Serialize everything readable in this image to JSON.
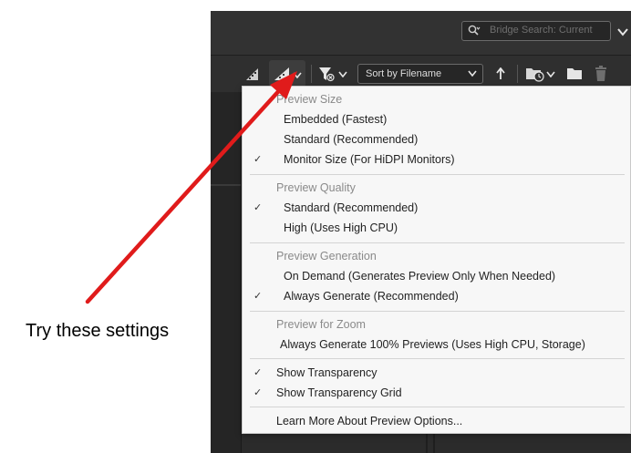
{
  "search": {
    "placeholder": "Bridge Search: Current"
  },
  "toolbar": {
    "sort_label": "Sort by Filename"
  },
  "menu": {
    "sections": [
      {
        "header": "Preview Size",
        "items": [
          {
            "label": "Embedded (Fastest)",
            "checked": false
          },
          {
            "label": "Standard (Recommended)",
            "checked": false
          },
          {
            "label": "Monitor Size (For HiDPI Monitors)",
            "checked": true
          }
        ]
      },
      {
        "header": "Preview Quality",
        "items": [
          {
            "label": "Standard (Recommended)",
            "checked": true
          },
          {
            "label": "High (Uses High CPU)",
            "checked": false
          }
        ]
      },
      {
        "header": "Preview Generation",
        "items": [
          {
            "label": "On Demand (Generates Preview Only When Needed)",
            "checked": false
          },
          {
            "label": "Always Generate (Recommended)",
            "checked": true
          }
        ]
      },
      {
        "header": "Preview for Zoom",
        "items": [
          {
            "label": "Always Generate 100% Previews (Uses High CPU, Storage)",
            "checked": false
          }
        ]
      }
    ],
    "toggles": [
      {
        "label": "Show Transparency",
        "checked": true
      },
      {
        "label": "Show Transparency Grid",
        "checked": true
      }
    ],
    "footer_link": "Learn More About Preview Options...",
    "check_glyph": "✓"
  },
  "annotation": {
    "text": "Try these settings",
    "arrow_color": "#e01b1b"
  }
}
